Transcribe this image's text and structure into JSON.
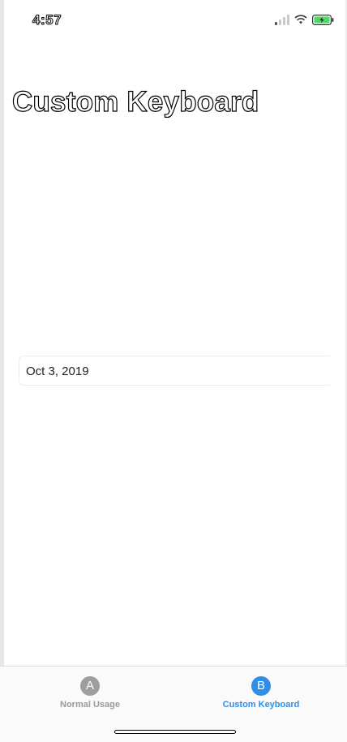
{
  "status_bar": {
    "time": "4:57",
    "icons": [
      "cellular-signal-icon",
      "wifi-icon",
      "battery-charging-icon"
    ],
    "battery_color": "#4cd964"
  },
  "page": {
    "title": "Custom Keyboard"
  },
  "date_field": {
    "value": "Oct 3, 2019"
  },
  "tab_bar": {
    "tabs": [
      {
        "badge": "A",
        "label": "Normal Usage",
        "selected": false
      },
      {
        "badge": "B",
        "label": "Custom Keyboard",
        "selected": true
      }
    ],
    "accent_color": "#2f8ee6",
    "inactive_color": "#9e9e9e"
  }
}
